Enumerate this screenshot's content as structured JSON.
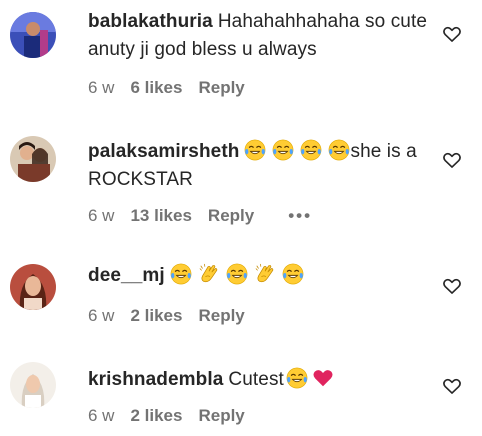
{
  "comments": [
    {
      "username": "bablakathuria",
      "text": "Hahahahhahaha so cute anuty ji god bless u always",
      "age": "6 w",
      "likes": "6 likes",
      "reply": "Reply",
      "avatar_icon": "avatar-photo-man-blue"
    },
    {
      "username": "palaksamirsheth",
      "text_after_emoji": "she is a ROCKSTAR",
      "emojis": [
        "laughing-tears-emoji",
        "laughing-tears-emoji",
        "laughing-tears-emoji",
        "laughing-tears-emoji"
      ],
      "age": "6 w",
      "likes": "13 likes",
      "reply": "Reply",
      "more": "•••",
      "avatar_icon": "avatar-photo-couple"
    },
    {
      "username": "dee__mj",
      "emojis": [
        "laughing-tears-emoji",
        "clapping-hands-emoji",
        "laughing-tears-emoji",
        "clapping-hands-emoji",
        "laughing-tears-emoji"
      ],
      "age": "6 w",
      "likes": "2 likes",
      "reply": "Reply",
      "avatar_icon": "avatar-photo-woman"
    },
    {
      "username": "krishnadembla",
      "text": "Cutest",
      "emojis": [
        "laughing-tears-emoji",
        "red-heart-emoji"
      ],
      "age": "6 w",
      "likes": "2 likes",
      "reply": "Reply",
      "avatar_icon": "avatar-photo-woman-white"
    }
  ],
  "colors": {
    "text": "#262626",
    "meta": "#737373",
    "heart_outline": "#262626",
    "emoji_yellow": "#FFCC33",
    "emoji_tears": "#4DA3FF",
    "red_heart": "#E0245E"
  }
}
